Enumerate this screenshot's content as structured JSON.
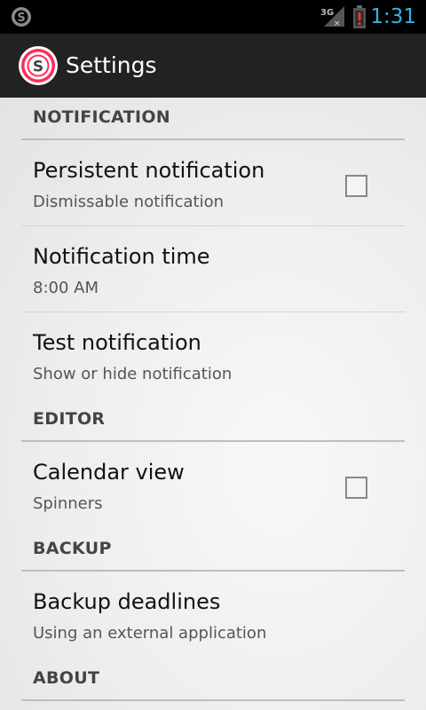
{
  "status_bar": {
    "time": "1:31",
    "network_label": "3G",
    "app_icon": "s-logo-icon",
    "battery_icon": "battery-alert-icon",
    "time_color": "#33b5e5"
  },
  "action_bar": {
    "title": "Settings",
    "logo_icon": "app-logo-icon",
    "logo_letter": "S"
  },
  "sections": {
    "notification": {
      "label": "NOTIFICATION",
      "items": [
        {
          "title": "Persistent notification",
          "summary": "Dismissable notification",
          "checked": false
        },
        {
          "title": "Notification time",
          "summary": "8:00 AM"
        },
        {
          "title": "Test notification",
          "summary": "Show or hide notification"
        }
      ]
    },
    "editor": {
      "label": "EDITOR",
      "items": [
        {
          "title": "Calendar view",
          "summary": "Spinners",
          "checked": false
        }
      ]
    },
    "backup": {
      "label": "BACKUP",
      "items": [
        {
          "title": "Backup deadlines",
          "summary": "Using an external application"
        }
      ]
    },
    "about": {
      "label": "ABOUT"
    }
  }
}
